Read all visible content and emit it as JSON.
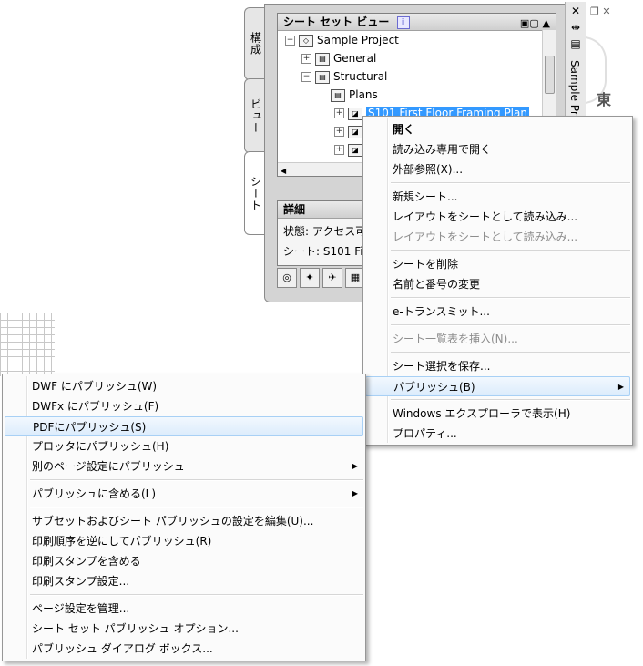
{
  "palette": {
    "tabs": [
      "構成",
      "ビュー",
      "シート"
    ],
    "title": "Sample Proje...",
    "tree_header": "シート セット ビュー",
    "tree": [
      {
        "label": "Sample Project",
        "exp": "−"
      },
      {
        "label": "General",
        "exp": "+"
      },
      {
        "label": "Structural",
        "exp": "−"
      },
      {
        "label": "Plans",
        "exp": ""
      },
      {
        "label": "S101 First Floor Framing Plan",
        "exp": "+"
      },
      {
        "label": "",
        "exp": "+"
      },
      {
        "label": "",
        "exp": "+"
      },
      {
        "label": "",
        "exp": "+"
      }
    ],
    "details_header": "詳細",
    "status_line": "状態: アクセス可",
    "sheet_line": "シート: S101 Fi",
    "viewcube_label": "東"
  },
  "context_menu": [
    {
      "label": "開く",
      "bold": true
    },
    {
      "label": "読み込み専用で開く"
    },
    {
      "label": "外部参照(X)..."
    },
    {
      "sep": true
    },
    {
      "label": "新規シート..."
    },
    {
      "label": "レイアウトをシートとして読み込み..."
    },
    {
      "label": "レイアウトをシートとして読み込み...",
      "disabled": true
    },
    {
      "sep": true
    },
    {
      "label": "シートを削除"
    },
    {
      "label": "名前と番号の変更"
    },
    {
      "sep": true
    },
    {
      "label": "e-トランスミット..."
    },
    {
      "sep": true
    },
    {
      "label": "シート一覧表を挿入(N)...",
      "disabled": true
    },
    {
      "sep": true
    },
    {
      "label": "シート選択を保存..."
    },
    {
      "label": "パブリッシュ(B)",
      "submenu": true,
      "highlight": true
    },
    {
      "sep": true
    },
    {
      "label": "Windows エクスプローラで表示(H)"
    },
    {
      "label": "プロパティ..."
    }
  ],
  "publish_menu": [
    {
      "label": "DWF にパブリッシュ(W)"
    },
    {
      "label": "DWFx にパブリッシュ(F)"
    },
    {
      "label": "PDFにパブリッシュ(S)",
      "highlight": true
    },
    {
      "label": "プロッタにパブリッシュ(H)"
    },
    {
      "label": "別のページ設定にパブリッシュ",
      "submenu": true
    },
    {
      "sep": true
    },
    {
      "label": "パブリッシュに含める(L)",
      "submenu": true
    },
    {
      "sep": true
    },
    {
      "label": "サブセットおよびシート パブリッシュの設定を編集(U)..."
    },
    {
      "label": "印刷順序を逆にしてパブリッシュ(R)"
    },
    {
      "label": "印刷スタンプを含める"
    },
    {
      "label": "印刷スタンプ設定..."
    },
    {
      "sep": true
    },
    {
      "label": "ページ設定を管理..."
    },
    {
      "label": "シート セット パブリッシュ オプション..."
    },
    {
      "label": "パブリッシュ ダイアログ ボックス..."
    }
  ]
}
